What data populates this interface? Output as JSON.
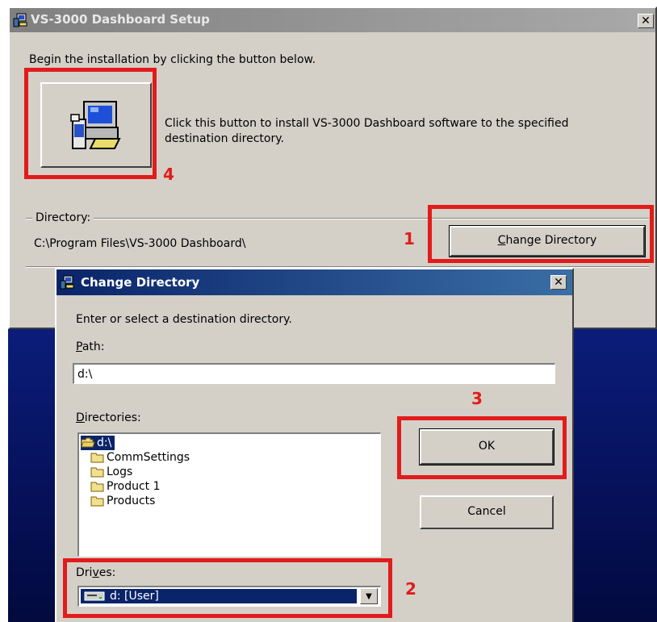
{
  "setup_window": {
    "title": "VS-3000 Dashboard Setup",
    "close_glyph": "✕",
    "intro_text": "Begin the installation by clicking the button below.",
    "install_button_description": "Click this button to install VS-3000 Dashboard software to the specified destination directory.",
    "directory_label": "Directory:",
    "directory_path": "C:\\Program Files\\VS-3000 Dashboard\\",
    "change_directory_button": {
      "mnemonic": "C",
      "rest": "hange Directory"
    }
  },
  "change_directory_dialog": {
    "title": "Change Directory",
    "close_glyph": "✕",
    "prompt": "Enter or select a destination directory.",
    "path_label": {
      "mnemonic": "P",
      "rest": "ath:"
    },
    "path_value": "d:\\",
    "directories_label": {
      "mnemonic": "D",
      "rest": "irectories:"
    },
    "directories": [
      {
        "name": "d:\\",
        "selected": true,
        "open": true
      },
      {
        "name": "CommSettings",
        "selected": false
      },
      {
        "name": "Logs",
        "selected": false
      },
      {
        "name": "Product 1",
        "selected": false
      },
      {
        "name": "Products",
        "selected": false
      }
    ],
    "ok_label": "OK",
    "cancel_label": "Cancel",
    "drives_label": {
      "pre": "Dri",
      "mnemonic": "v",
      "rest": "es:"
    },
    "drive_value": "d: [User]"
  },
  "annotations": [
    "1",
    "2",
    "3",
    "4"
  ],
  "colors": {
    "annotation_red": "#e21b1b",
    "dialog_face": "#d4d0c8",
    "active_title": "#0a246a",
    "inactive_title": "#808080",
    "selection": "#0a246a"
  }
}
